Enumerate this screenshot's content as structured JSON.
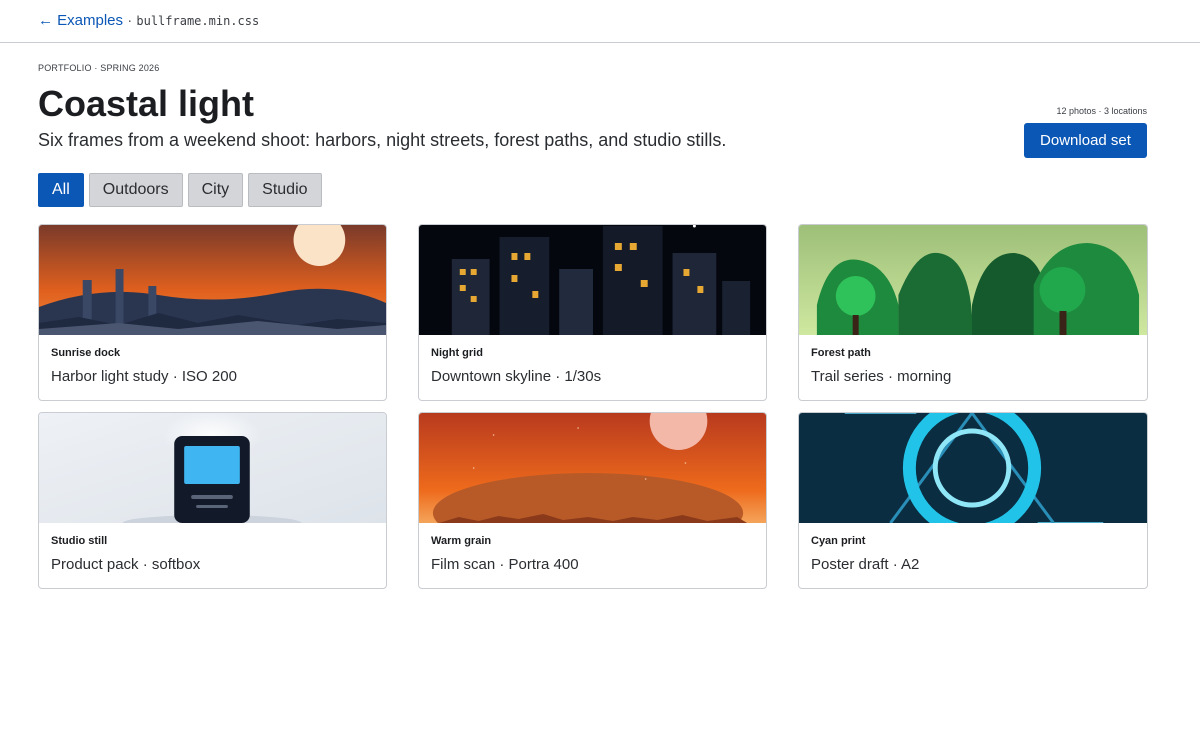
{
  "topbar": {
    "back_label": "← Examples",
    "separator": "·",
    "file": "bullframe.min.css"
  },
  "header": {
    "eyebrow": "PORTFOLIO · SPRING 2026",
    "title": "Coastal light",
    "subtitle": "Six frames from a weekend shoot: harbors, night streets, forest paths, and studio stills.",
    "meta": "12 photos · 3 locations",
    "download_label": "Download set"
  },
  "filters": [
    {
      "label": "All",
      "active": true
    },
    {
      "label": "Outdoors",
      "active": false
    },
    {
      "label": "City",
      "active": false
    },
    {
      "label": "Studio",
      "active": false
    }
  ],
  "cards": [
    {
      "title": "Sunrise dock",
      "subtitle": "Harbor light study · ISO 200"
    },
    {
      "title": "Night grid",
      "subtitle": "Downtown skyline · 1/30s"
    },
    {
      "title": "Forest path",
      "subtitle": "Trail series · morning"
    },
    {
      "title": "Studio still",
      "subtitle": "Product pack · softbox"
    },
    {
      "title": "Warm grain",
      "subtitle": "Film scan · Portra 400"
    },
    {
      "title": "Cyan print",
      "subtitle": "Poster draft · A2"
    }
  ],
  "colors": {
    "accent": "#0b57b5",
    "filter_bg": "#d4d5d8",
    "border": "#c9ccd0"
  }
}
